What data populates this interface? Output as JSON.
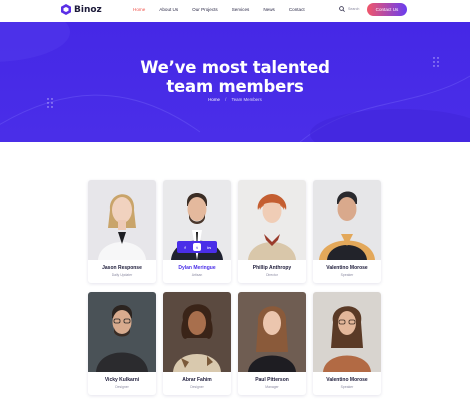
{
  "brand": {
    "name": "Binoz",
    "accent": "#4a2ee8",
    "highlight": "#f0514a"
  },
  "nav": {
    "items": [
      {
        "label": "Home",
        "active": true
      },
      {
        "label": "About Us",
        "active": false
      },
      {
        "label": "Our Projects",
        "active": false
      },
      {
        "label": "Services",
        "active": false
      },
      {
        "label": "News",
        "active": false
      },
      {
        "label": "Contact",
        "active": false
      }
    ],
    "search_label": "Search",
    "contact_button": "Contact Us"
  },
  "hero": {
    "title_line1": "We’ve most talented",
    "title_line2": "team members",
    "breadcrumb": {
      "home": "Home",
      "separator": "/",
      "current": "Team Members"
    }
  },
  "team": [
    {
      "name": "Jason Response",
      "role": "Daily Updater"
    },
    {
      "name": "Dylan Meringue",
      "role": "Artisan",
      "socials": [
        "f",
        "t",
        "in"
      ]
    },
    {
      "name": "Phillip Anthropy",
      "role": "Director"
    },
    {
      "name": "Valentino Morose",
      "role": "Speaker"
    },
    {
      "name": "Vicky Kulkarni",
      "role": "Designer"
    },
    {
      "name": "Abrar Fahim",
      "role": "Designer"
    },
    {
      "name": "Paul Pitterson",
      "role": "Manager"
    },
    {
      "name": "Valentino Morose",
      "role": "Speaker"
    }
  ]
}
